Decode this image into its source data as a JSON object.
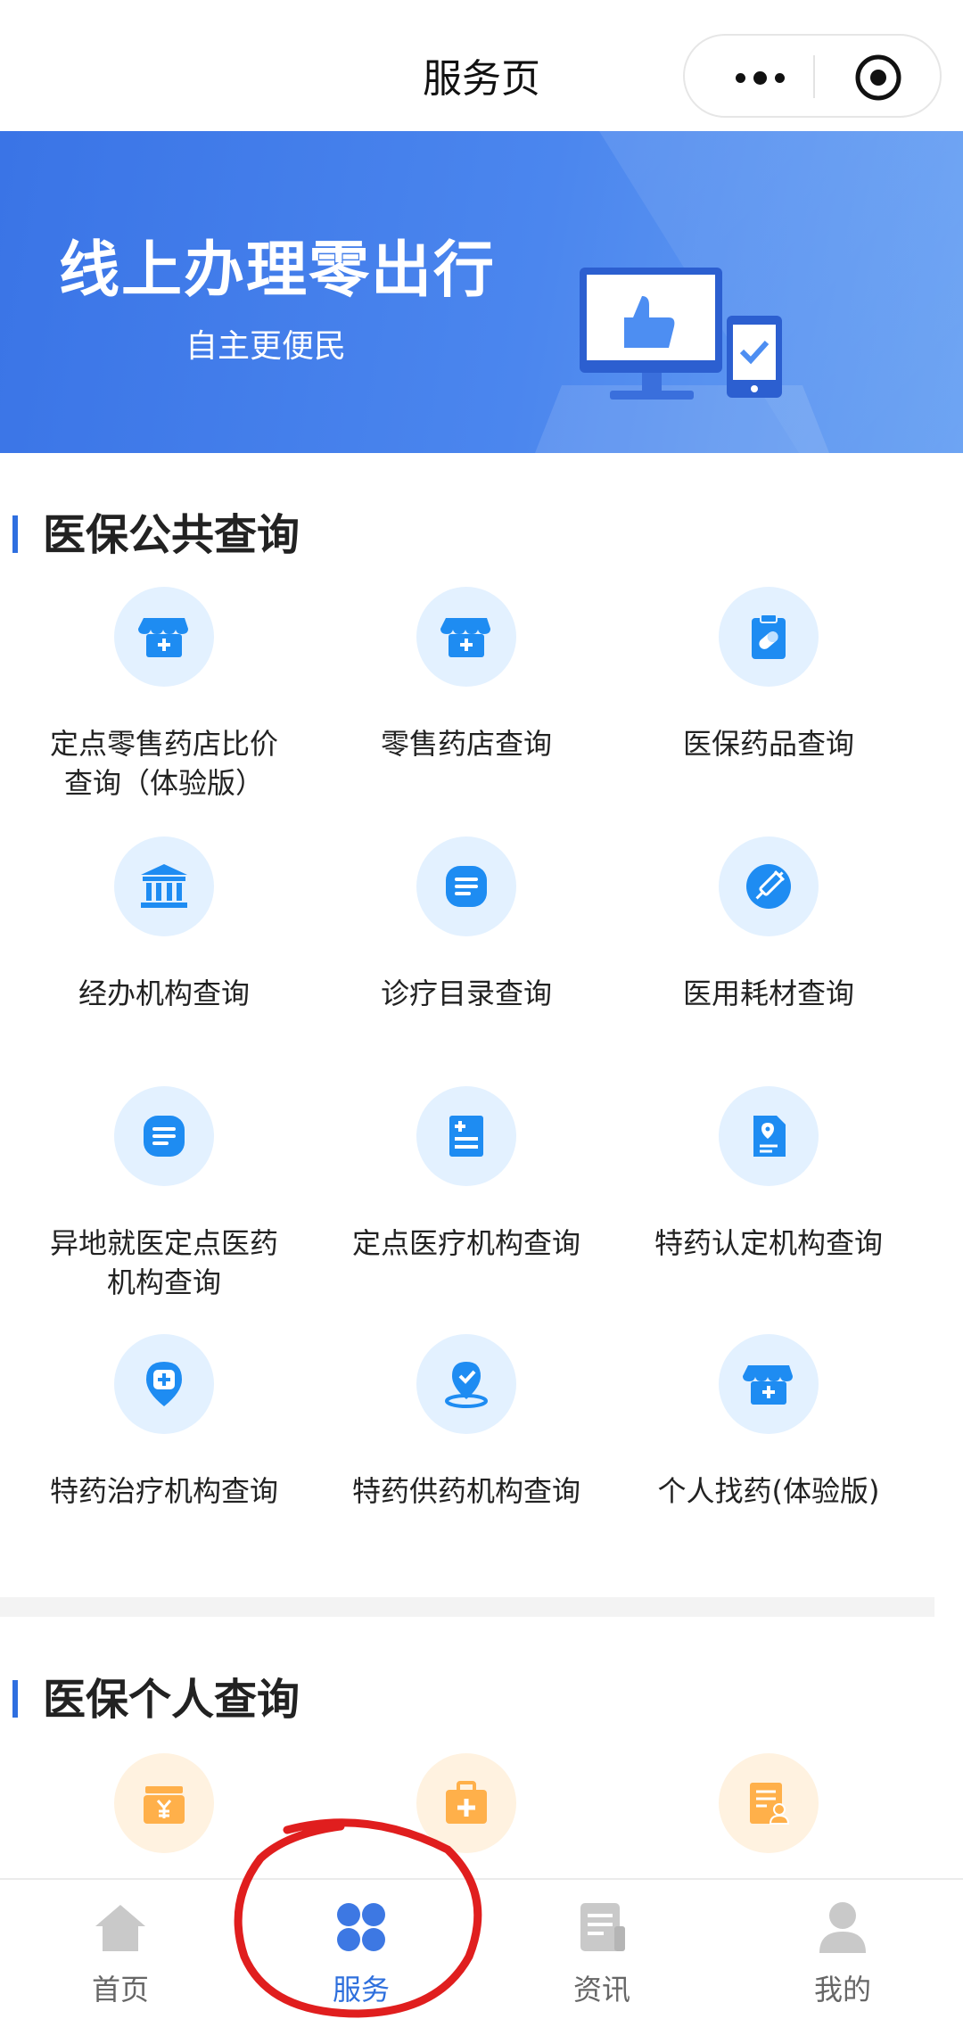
{
  "header": {
    "title": "服务页"
  },
  "banner": {
    "headline": "线上办理零出行",
    "subtitle": "自主更便民"
  },
  "public_section": {
    "title": "医保公共查询",
    "items": [
      {
        "label": "定点零售药店比价查询（体验版）",
        "icon": "pharmacy-store-icon"
      },
      {
        "label": "零售药店查询",
        "icon": "pharmacy-store-icon"
      },
      {
        "label": "医保药品查询",
        "icon": "medicine-clipboard-icon"
      },
      {
        "label": "经办机构查询",
        "icon": "bank-building-icon"
      },
      {
        "label": "诊疗目录查询",
        "icon": "list-document-icon"
      },
      {
        "label": "医用耗材查询",
        "icon": "syringe-icon"
      },
      {
        "label": "异地就医定点医药机构查询",
        "icon": "list-document-icon"
      },
      {
        "label": "定点医疗机构查询",
        "icon": "medical-record-icon"
      },
      {
        "label": "特药认定机构查询",
        "icon": "location-document-icon"
      },
      {
        "label": "特药治疗机构查询",
        "icon": "medical-pin-icon"
      },
      {
        "label": "特药供药机构查询",
        "icon": "location-check-icon"
      },
      {
        "label": "个人找药(体验版)",
        "icon": "pharmacy-store-icon"
      }
    ]
  },
  "personal_section": {
    "title": "医保个人查询",
    "items": [
      {
        "icon": "yuan-wallet-icon"
      },
      {
        "icon": "medical-kit-icon"
      },
      {
        "icon": "person-document-icon"
      }
    ]
  },
  "tabbar": {
    "items": [
      {
        "label": "首页",
        "icon": "home-icon"
      },
      {
        "label": "服务",
        "icon": "grid-service-icon"
      },
      {
        "label": "资讯",
        "icon": "news-icon"
      },
      {
        "label": "我的",
        "icon": "profile-icon"
      }
    ],
    "active_index": 1
  },
  "colors": {
    "brand": "#2f6fe0",
    "icon_blue": "#1e8cf2",
    "icon_orange": "#ffb04a",
    "annotation": "#e01e1e"
  }
}
